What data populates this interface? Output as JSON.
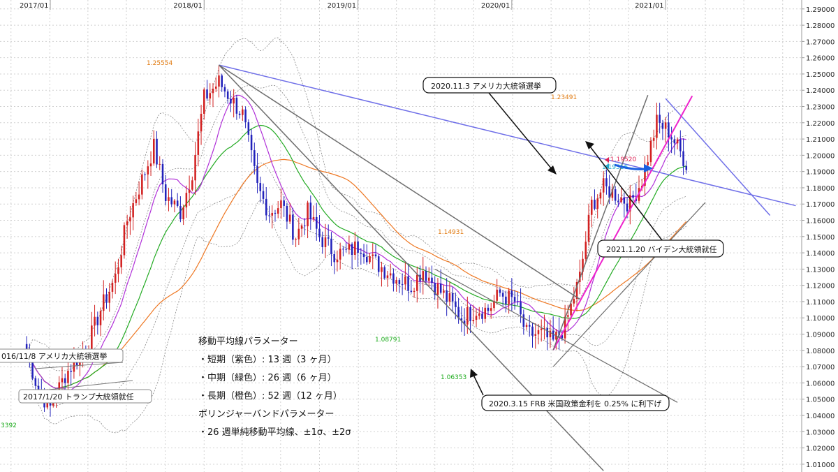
{
  "chart_data": {
    "type": "candlestick",
    "x_tick_labels": [
      "2017/01",
      "2018/01",
      "2019/01",
      "2020/01",
      "2021/01"
    ],
    "y_tick_labels": [
      "1.29000",
      "1.28000",
      "1.27000",
      "1.26000",
      "1.25000",
      "1.24000",
      "1.23000",
      "1.22000",
      "1.21000",
      "1.20000",
      "1.19000",
      "1.18000",
      "1.17000",
      "1.16000",
      "1.15000",
      "1.14000",
      "1.13000",
      "1.12000",
      "1.11000",
      "1.10000",
      "1.09000",
      "1.08000",
      "1.07000",
      "1.06000",
      "1.05000",
      "1.04000",
      "1.03000",
      "1.02000",
      "1.01000"
    ],
    "ylim": [
      1.0052,
      1.2955
    ],
    "xlim": [
      "2016-09-05",
      "2021-11-15"
    ],
    "x_ticks": [
      "2017-01-02",
      "2018-01-01",
      "2018-12-31",
      "2019-12-30",
      "2020-12-28"
    ],
    "grid": true,
    "colors": {
      "up": "#d22020",
      "down": "#2222bb",
      "ma_short": "#b030d8",
      "ma_mid": "#22aa22",
      "ma_long": "#ee7722",
      "bb": "#888888",
      "trend_blue": "#6f6fe8",
      "trend_gray": "#6d6d6d",
      "trend_pink": "#ee22cc",
      "arrow_blue": "#1a5fe0",
      "price_red": "#dd2255",
      "price_cyan": "#22aacc"
    },
    "weekly_closes": [
      [
        "2016-11-07",
        1.08
      ],
      [
        "2016-12-05",
        1.055
      ],
      [
        "2017-01-02",
        1.045
      ],
      [
        "2017-02-06",
        1.065
      ],
      [
        "2017-03-06",
        1.075
      ],
      [
        "2017-04-03",
        1.085
      ],
      [
        "2017-05-01",
        1.105
      ],
      [
        "2017-06-05",
        1.125
      ],
      [
        "2017-07-03",
        1.16
      ],
      [
        "2017-08-07",
        1.185
      ],
      [
        "2017-09-04",
        1.205
      ],
      [
        "2017-10-02",
        1.175
      ],
      [
        "2017-11-06",
        1.165
      ],
      [
        "2017-12-04",
        1.19
      ],
      [
        "2018-01-01",
        1.235
      ],
      [
        "2018-02-05",
        1.245
      ],
      [
        "2018-03-05",
        1.235
      ],
      [
        "2018-04-02",
        1.225
      ],
      [
        "2018-05-07",
        1.18
      ],
      [
        "2018-06-04",
        1.165
      ],
      [
        "2018-07-02",
        1.17
      ],
      [
        "2018-08-06",
        1.15
      ],
      [
        "2018-09-03",
        1.165
      ],
      [
        "2018-10-01",
        1.15
      ],
      [
        "2018-11-05",
        1.14
      ],
      [
        "2018-12-03",
        1.14
      ],
      [
        "2019-01-07",
        1.145
      ],
      [
        "2019-02-04",
        1.135
      ],
      [
        "2019-03-04",
        1.13
      ],
      [
        "2019-04-01",
        1.125
      ],
      [
        "2019-05-06",
        1.12
      ],
      [
        "2019-06-03",
        1.13
      ],
      [
        "2019-07-01",
        1.12
      ],
      [
        "2019-08-05",
        1.11
      ],
      [
        "2019-09-02",
        1.1
      ],
      [
        "2019-10-07",
        1.105
      ],
      [
        "2019-11-04",
        1.105
      ],
      [
        "2019-12-02",
        1.115
      ],
      [
        "2020-01-06",
        1.11
      ],
      [
        "2020-02-03",
        1.09
      ],
      [
        "2020-03-09",
        1.09
      ],
      [
        "2020-04-06",
        1.085
      ],
      [
        "2020-05-04",
        1.095
      ],
      [
        "2020-06-08",
        1.125
      ],
      [
        "2020-07-06",
        1.17
      ],
      [
        "2020-08-03",
        1.18
      ],
      [
        "2020-09-07",
        1.175
      ],
      [
        "2020-10-05",
        1.17
      ],
      [
        "2020-11-02",
        1.185
      ],
      [
        "2020-12-07",
        1.22
      ],
      [
        "2021-01-04",
        1.215
      ],
      [
        "2021-01-25",
        1.205
      ],
      [
        "2021-02-15",
        1.195
      ]
    ],
    "annotations": {
      "high_2018": "1.25554",
      "high_2021": "1.23491",
      "peak_2020": "1.14931",
      "low_2019": "1.08791",
      "low_2020": "1.06353",
      "low_2016": "3392",
      "price_bid": "1.19520",
      "price_ask": "1.19516"
    },
    "callouts": {
      "us_election_2016": "016/11/8 アメリカ大統領選挙",
      "trump_inauguration": "2017/1/20 トランプ大統領就任",
      "us_election_2020": "2020.11.3 アメリカ大統領選挙",
      "biden_inauguration": "2021.1.20 バイデン大統領就任",
      "fed_cut": "2020.3.15 FRB 米国政策金利を 0.25% に利下げ"
    },
    "legend_lines": [
      "移動平均線パラメーター",
      "・短期（紫色）: 13 週（3 ヶ月）",
      "・中期（緑色）: 26 週（6 ヶ月）",
      "・長期（橙色）: 52 週（12 ヶ月）",
      "ボリンジャーバンドパラメーター",
      "・26 週単純移動平均線、±1σ、±2σ"
    ]
  }
}
